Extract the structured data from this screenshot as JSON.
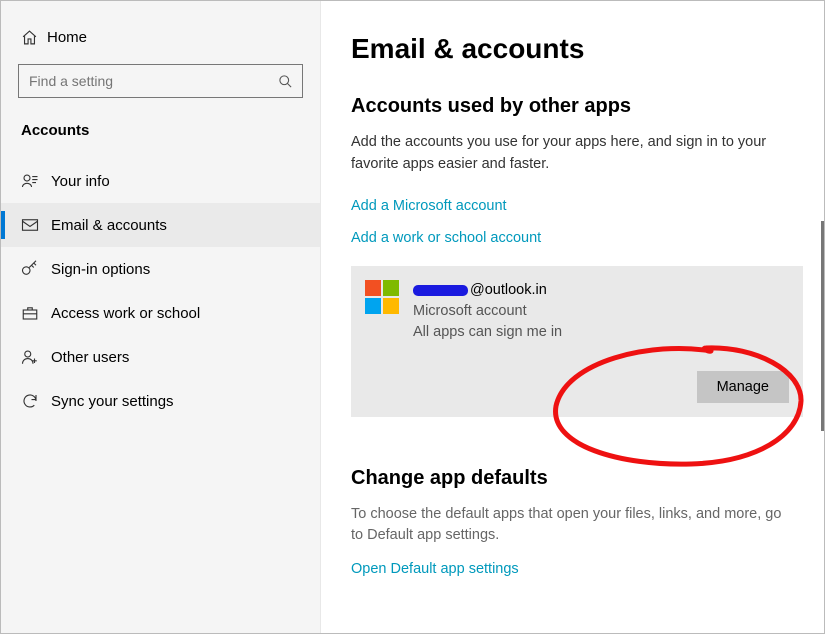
{
  "sidebar": {
    "home_label": "Home",
    "search_placeholder": "Find a setting",
    "category_title": "Accounts",
    "items": [
      {
        "label": "Your info"
      },
      {
        "label": "Email & accounts"
      },
      {
        "label": "Sign-in options"
      },
      {
        "label": "Access work or school"
      },
      {
        "label": "Other users"
      },
      {
        "label": "Sync your settings"
      }
    ]
  },
  "main": {
    "title": "Email & accounts",
    "section1": {
      "title": "Accounts used by other apps",
      "description": "Add the accounts you use for your apps here, and sign in to your favorite apps easier and faster.",
      "link_ms": "Add a Microsoft account",
      "link_work": "Add a work or school account"
    },
    "account": {
      "email_suffix": "@outlook.in",
      "type": "Microsoft account",
      "status": "All apps can sign me in",
      "manage_label": "Manage"
    },
    "section2": {
      "title": "Change app defaults",
      "description": "To choose the default apps that open your files, links, and more, go to Default app settings.",
      "link": "Open Default app settings"
    }
  }
}
